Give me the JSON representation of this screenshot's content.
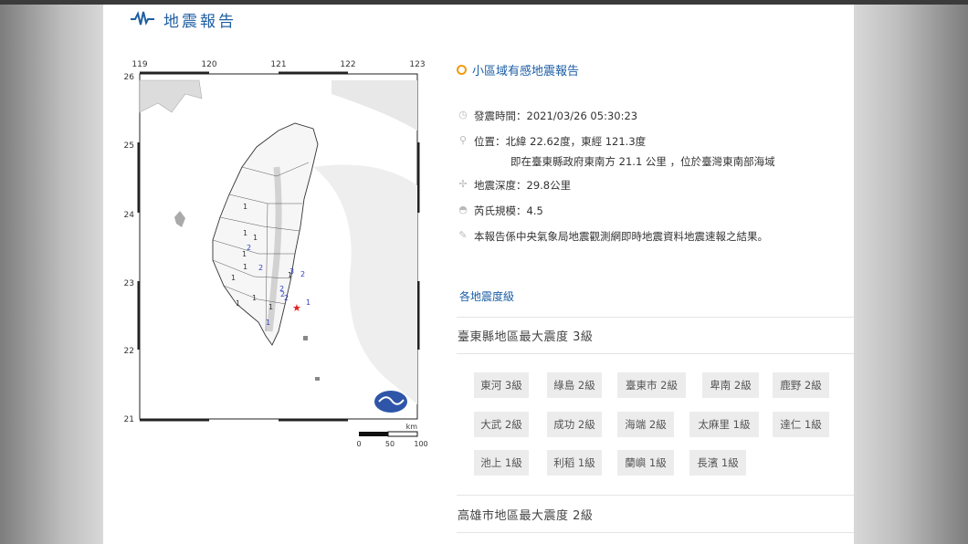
{
  "header": {
    "title": "地震報告"
  },
  "map": {
    "lon_ticks": [
      "119",
      "120",
      "121",
      "122",
      "123"
    ],
    "lat_ticks": [
      "26",
      "25",
      "24",
      "23",
      "22",
      "21"
    ],
    "scale_unit": "km",
    "scale_labels": [
      "0",
      "50",
      "100"
    ],
    "intensity_marks": [
      "1",
      "1",
      "1",
      "1",
      "1",
      "1",
      "1",
      "1",
      "1",
      "2",
      "2",
      "2",
      "2",
      "2",
      "3",
      "2",
      "1",
      "1",
      "1"
    ]
  },
  "report": {
    "title": "小區域有感地震報告",
    "time": "發震時間：2021/03/26 05:30:23",
    "location": "位置：北緯 22.62度，東經 121.3度",
    "location_detail": "即在臺東縣政府東南方 21.1 公里 ，位於臺灣東南部海域",
    "depth": "地震深度：29.8公里",
    "magnitude": "芮氏規模：4.5",
    "note": "本報告係中央氣象局地震觀測網即時地震資料地震速報之結果。"
  },
  "levels_link": "各地震度級",
  "regions": [
    {
      "title": "臺東縣地區最大震度 3級",
      "stations": [
        "東河 3級",
        "綠島 2級",
        "臺東市 2級",
        "卑南 2級",
        "鹿野 2級",
        "大武 2級",
        "成功 2級",
        "海端 2級",
        "太麻里 1級",
        "達仁 1級",
        "池上 1級",
        "利稻 1級",
        "蘭嶼 1級",
        "長濱 1級"
      ]
    },
    {
      "title": "高雄市地區最大震度 2級"
    }
  ],
  "colors": {
    "accent": "#1d5ea5",
    "dot": "#f19a0f",
    "epicenter": "#e02020",
    "chip_bg": "#ececec"
  }
}
